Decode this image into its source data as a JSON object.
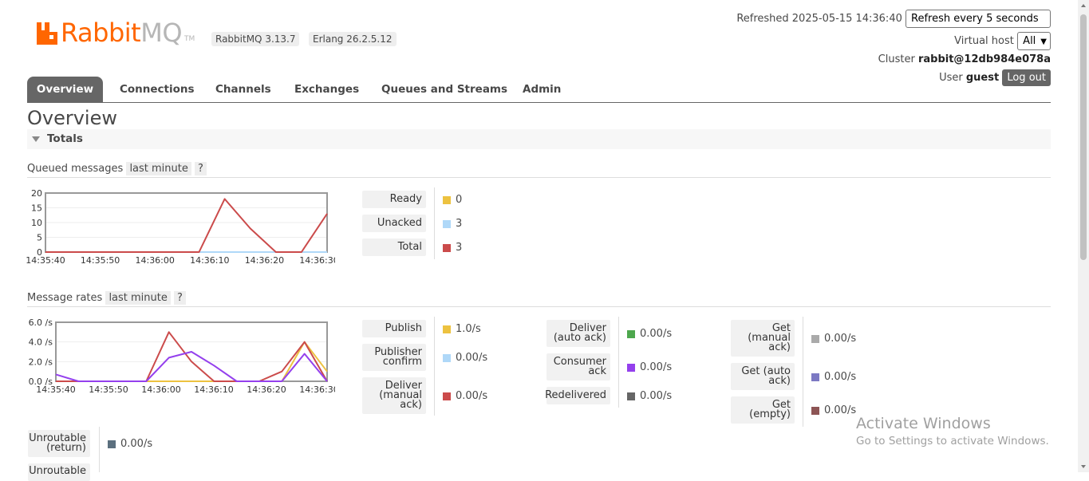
{
  "header": {
    "logo_text_primary": "Rabbit",
    "logo_text_secondary": "MQ",
    "logo_tm": "TM",
    "version_badge": "RabbitMQ 3.13.7",
    "erlang_badge": "Erlang 26.2.5.12",
    "refreshed_label": "Refreshed 2025-05-15 14:36:40",
    "refresh_select": "Refresh every 5 seconds",
    "vhost_label": "Virtual host",
    "vhost_select": "All",
    "cluster_label": "Cluster",
    "cluster_value": "rabbit@12db984e078a",
    "user_label": "User",
    "user_value": "guest",
    "logout_label": "Log out",
    "brand_color": "#ff6600"
  },
  "tabs": [
    {
      "label": "Overview",
      "active": true
    },
    {
      "label": "Connections",
      "active": false
    },
    {
      "label": "Channels",
      "active": false
    },
    {
      "label": "Exchanges",
      "active": false
    },
    {
      "label": "Queues and Streams",
      "active": false
    },
    {
      "label": "Admin",
      "active": false
    }
  ],
  "page_title": "Overview",
  "section_title": "Totals",
  "queued": {
    "title": "Queued messages",
    "range": "last minute",
    "help": "?",
    "legend": [
      {
        "label": "Ready",
        "value": "0",
        "color": "#edc240"
      },
      {
        "label": "Unacked",
        "value": "3",
        "color": "#afd8f8"
      },
      {
        "label": "Total",
        "value": "3",
        "color": "#cb4b4b"
      }
    ]
  },
  "rates": {
    "title": "Message rates",
    "range": "last minute",
    "help": "?",
    "col1": [
      {
        "label": "Publish",
        "value": "1.0/s",
        "color": "#edc240"
      },
      {
        "label": "Publisher confirm",
        "value": "0.00/s",
        "color": "#afd8f8"
      },
      {
        "label": "Deliver (manual ack)",
        "value": "0.00/s",
        "color": "#cb4b4b"
      }
    ],
    "col2": [
      {
        "label": "Deliver (auto ack)",
        "value": "0.00/s",
        "color": "#4da74d"
      },
      {
        "label": "Consumer ack",
        "value": "0.00/s",
        "color": "#9440ed"
      },
      {
        "label": "Redelivered",
        "value": "0.00/s",
        "color": "#666666"
      }
    ],
    "col3": [
      {
        "label": "Get (manual ack)",
        "value": "0.00/s",
        "color": "#aaaaaa"
      },
      {
        "label": "Get (auto ack)",
        "value": "0.00/s",
        "color": "#7c79c3"
      },
      {
        "label": "Get (empty)",
        "value": "0.00/s",
        "color": "#8d5555"
      }
    ],
    "col0": [
      {
        "label": "Unroutable (return)",
        "value": "0.00/s",
        "color": "#5b6f7e"
      },
      {
        "label": "Unroutable",
        "value": "",
        "color": "#5b6f7e"
      }
    ]
  },
  "watermark": {
    "line1": "Activate Windows",
    "line2": "Go to Settings to activate Windows."
  },
  "chart_data": [
    {
      "type": "line",
      "title": "Queued messages",
      "x": [
        "14:35:40",
        "14:35:45",
        "14:35:50",
        "14:35:55",
        "14:36:00",
        "14:36:05",
        "14:36:10",
        "14:36:15",
        "14:36:20",
        "14:36:25",
        "14:36:30",
        "14:36:35"
      ],
      "xticks": [
        "14:35:40",
        "14:35:50",
        "14:36:00",
        "14:36:10",
        "14:36:20",
        "14:36:30"
      ],
      "yticks": [
        "20",
        "15",
        "10",
        "5",
        "0"
      ],
      "ylim": [
        0,
        20
      ],
      "series": [
        {
          "name": "Ready",
          "color": "#edc240",
          "values": [
            0,
            0,
            0,
            0,
            0,
            0,
            0,
            0,
            0,
            0,
            0,
            0
          ]
        },
        {
          "name": "Unacked",
          "color": "#afd8f8",
          "values": [
            0,
            0,
            0,
            0,
            0,
            0,
            0,
            0,
            0,
            0,
            0,
            0
          ]
        },
        {
          "name": "Total",
          "color": "#cb4b4b",
          "values": [
            0,
            0,
            0,
            0,
            0,
            0,
            0,
            18,
            8,
            0,
            0,
            13
          ]
        }
      ]
    },
    {
      "type": "line",
      "title": "Message rates",
      "x": [
        "14:35:38",
        "14:35:42",
        "14:35:47",
        "14:35:52",
        "14:35:57",
        "14:36:02",
        "14:36:07",
        "14:36:12",
        "14:36:17",
        "14:36:22",
        "14:36:27",
        "14:36:32",
        "14:36:37"
      ],
      "xticks": [
        "14:35:40",
        "14:35:50",
        "14:36:00",
        "14:36:10",
        "14:36:20",
        "14:36:30"
      ],
      "yticks": [
        "6.0 /s",
        "4.0 /s",
        "2.0 /s",
        "0.0 /s"
      ],
      "ylim": [
        0,
        6
      ],
      "series": [
        {
          "name": "Publish",
          "color": "#edc240",
          "values": [
            0,
            0,
            0,
            0,
            0,
            0,
            0,
            0,
            0,
            0,
            0,
            4.0,
            1.0
          ]
        },
        {
          "name": "Deliver (manual ack)",
          "color": "#cb4b4b",
          "values": [
            0,
            0,
            0,
            0,
            0,
            5.0,
            2.0,
            0,
            0,
            0,
            1.0,
            4.0,
            0
          ]
        },
        {
          "name": "Consumer ack",
          "color": "#9440ed",
          "values": [
            0.7,
            0,
            0,
            0,
            0,
            2.4,
            3.0,
            1.6,
            0,
            0,
            0,
            2.8,
            0
          ]
        }
      ]
    }
  ]
}
